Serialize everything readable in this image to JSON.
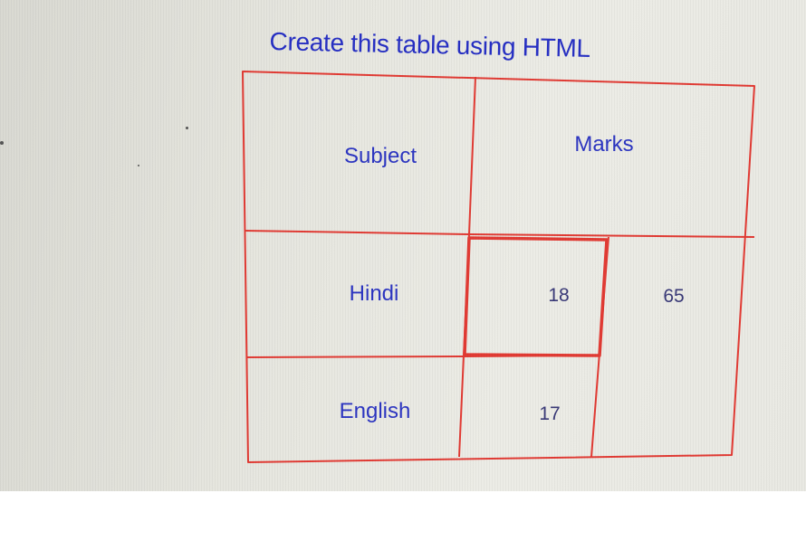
{
  "instruction": "Create this table using HTML",
  "table": {
    "header": {
      "subject": "Subject",
      "marks": "Marks"
    },
    "rows": [
      {
        "subject": "Hindi",
        "mark": "18",
        "total": "65"
      },
      {
        "subject": "English",
        "mark": "17"
      }
    ]
  },
  "colors": {
    "text": "#2d36c2",
    "border": "#e23b34",
    "background": "#e6e6df"
  }
}
